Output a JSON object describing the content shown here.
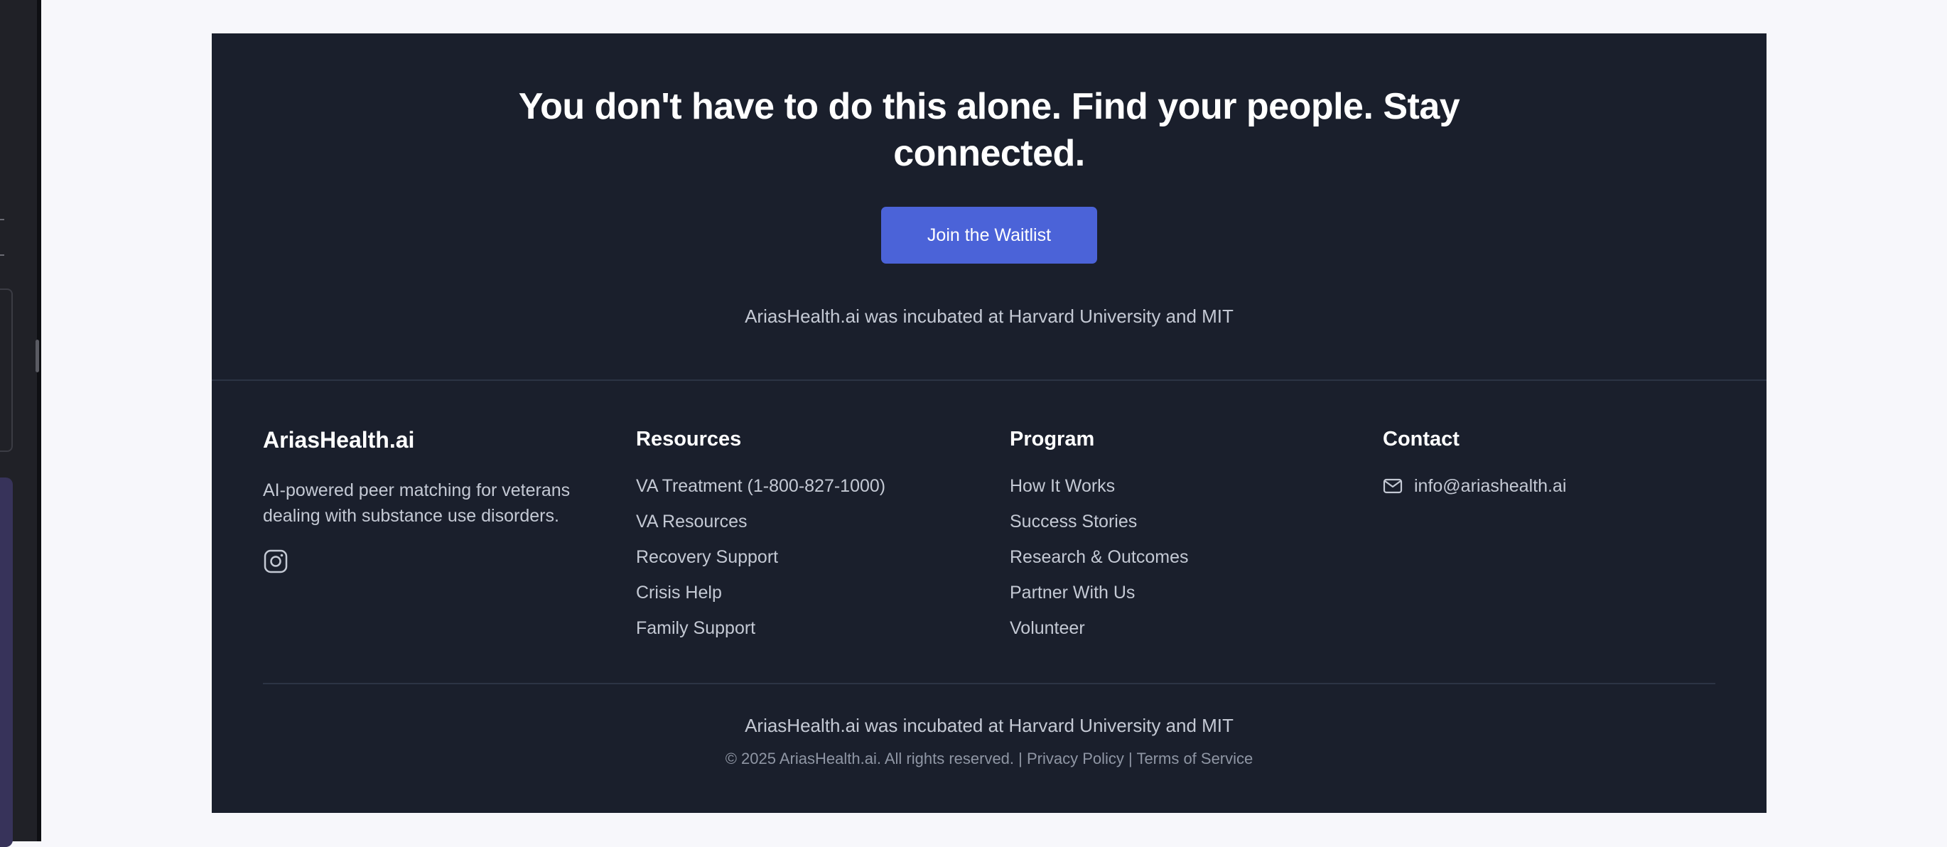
{
  "cta": {
    "headline": "You don't have to do this alone. Find your people. Stay connected.",
    "button_label": "Join the Waitlist",
    "incubated": "AriasHealth.ai was incubated at Harvard University and MIT"
  },
  "brand": {
    "name": "AriasHealth.ai",
    "description": "AI-powered peer matching for veterans dealing with substance use disorders.",
    "social_icon": "instagram-icon"
  },
  "resources": {
    "title": "Resources",
    "links": [
      "VA Treatment (1-800-827-1000)",
      "VA Resources",
      "Recovery Support",
      "Crisis Help",
      "Family Support"
    ]
  },
  "program": {
    "title": "Program",
    "links": [
      "How It Works",
      "Success Stories",
      "Research & Outcomes",
      "Partner With Us",
      "Volunteer"
    ]
  },
  "contact": {
    "title": "Contact",
    "icon": "mail-icon",
    "email": "info@ariashealth.ai"
  },
  "bottom": {
    "incubated": "AriasHealth.ai was incubated at Harvard University and MIT",
    "copyright": "© 2025 AriasHealth.ai. All rights reserved. | ",
    "privacy": "Privacy Policy",
    "separator": " | ",
    "terms": "Terms of Service"
  },
  "colors": {
    "footer_bg": "#1a1f2c",
    "accent": "#4b63d8",
    "page_bg": "#f7f7fb"
  }
}
